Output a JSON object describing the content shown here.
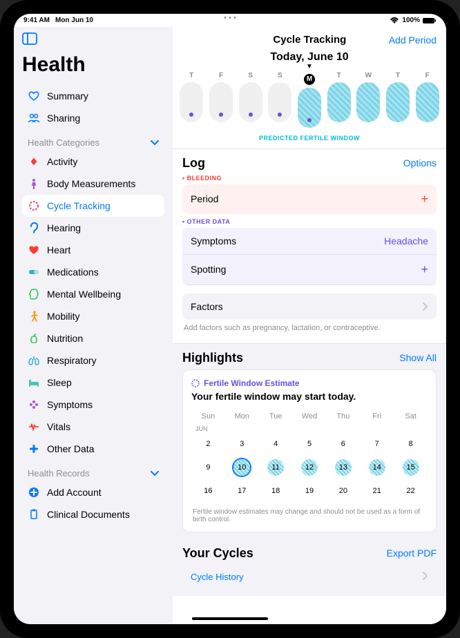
{
  "status": {
    "time": "9:41 AM",
    "date": "Mon Jun 10",
    "battery": "100%"
  },
  "sidebar": {
    "title": "Health",
    "summary": "Summary",
    "sharing": "Sharing",
    "categories_header": "Health Categories",
    "records_header": "Health Records",
    "items": [
      {
        "label": "Activity",
        "color": "#ff3b30"
      },
      {
        "label": "Body Measurements",
        "color": "#af52de"
      },
      {
        "label": "Cycle Tracking",
        "color": "#ff2d55",
        "selected": true
      },
      {
        "label": "Hearing",
        "color": "#007aff"
      },
      {
        "label": "Heart",
        "color": "#ff3b30"
      },
      {
        "label": "Medications",
        "color": "#30b0c7"
      },
      {
        "label": "Mental Wellbeing",
        "color": "#34c759"
      },
      {
        "label": "Mobility",
        "color": "#ff9500"
      },
      {
        "label": "Nutrition",
        "color": "#34c759"
      },
      {
        "label": "Respiratory",
        "color": "#30b0c7"
      },
      {
        "label": "Sleep",
        "color": "#48c4b7"
      },
      {
        "label": "Symptoms",
        "color": "#af52de"
      },
      {
        "label": "Vitals",
        "color": "#ff3b30"
      },
      {
        "label": "Other Data",
        "color": "#007aff"
      }
    ],
    "records": [
      {
        "label": "Add Account",
        "color": "#007aff"
      },
      {
        "label": "Clinical Documents",
        "color": "#007aff"
      }
    ]
  },
  "main": {
    "title": "Cycle Tracking",
    "add_period": "Add Period",
    "today_label": "Today, June 10",
    "week_days": [
      "T",
      "F",
      "S",
      "S",
      "M",
      "T",
      "W",
      "T",
      "F"
    ],
    "today_index": 4,
    "fertile_start": 4,
    "fertile_label": "PREDICTED FERTILE WINDOW",
    "log": {
      "title": "Log",
      "options": "Options",
      "bleeding_label": "• BLEEDING",
      "period": "Period",
      "other_label": "• OTHER DATA",
      "symptoms": "Symptoms",
      "symptoms_value": "Headache",
      "spotting": "Spotting",
      "factors": "Factors",
      "factors_hint": "Add factors such as pregnancy, lactation, or contraceptive."
    },
    "highlights": {
      "title": "Highlights",
      "show_all": "Show All",
      "card_label": "Fertile Window Estimate",
      "card_text": "Your fertile window may start today.",
      "weekday_headers": [
        "Sun",
        "Mon",
        "Tue",
        "Wed",
        "Thu",
        "Fri",
        "Sat"
      ],
      "month": "JUN",
      "weeks": [
        [
          2,
          3,
          4,
          5,
          6,
          7,
          8
        ],
        [
          9,
          10,
          11,
          12,
          13,
          14,
          15
        ],
        [
          16,
          17,
          18,
          19,
          20,
          21,
          22
        ]
      ],
      "today_day": 10,
      "fertile_days": [
        10,
        11,
        12,
        13,
        14,
        15
      ],
      "disclaimer": "Fertile window estimates may change and should not be used as a form of birth control."
    },
    "cycles": {
      "title": "Your Cycles",
      "export": "Export PDF",
      "history": "Cycle History"
    }
  }
}
